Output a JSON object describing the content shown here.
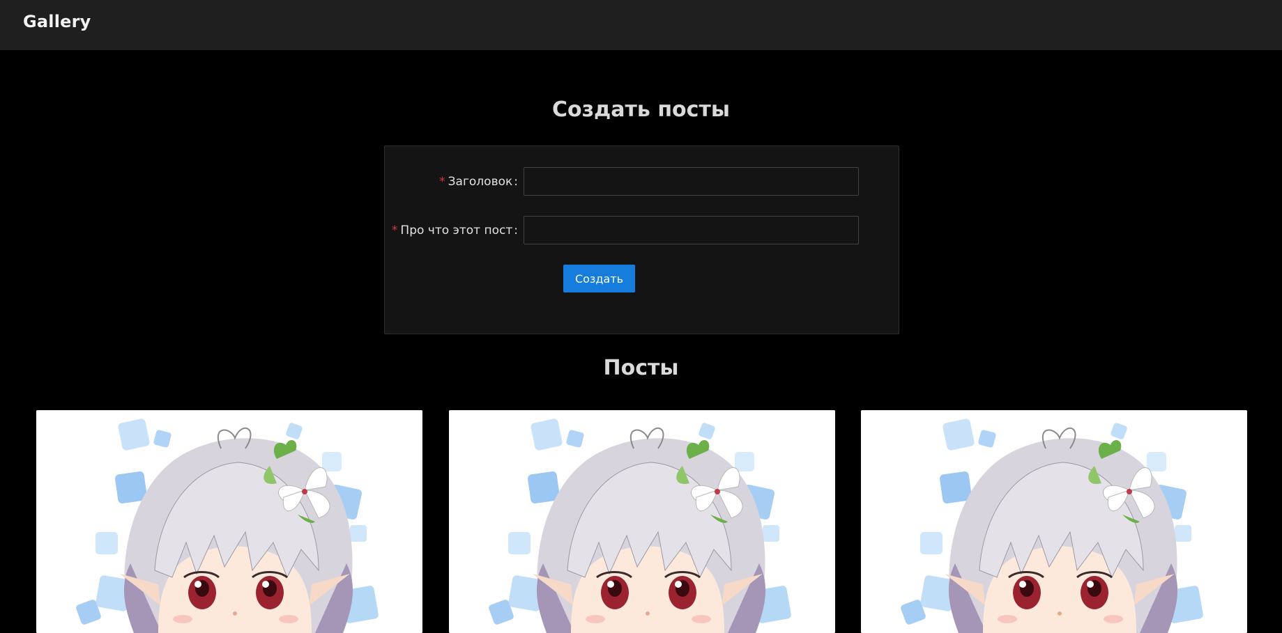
{
  "header": {
    "title": "Gallery"
  },
  "create": {
    "heading": "Создать посты",
    "fields": {
      "title_label": "Заголовок",
      "about_label": "Про что этот пост",
      "required_mark": "*",
      "colon": ":",
      "title_value": "",
      "about_value": ""
    },
    "submit_label": "Создать"
  },
  "posts": {
    "heading": "Посты",
    "items": [
      {
        "image": "anime-girl-illustration"
      },
      {
        "image": "anime-girl-illustration"
      },
      {
        "image": "anime-girl-illustration"
      }
    ]
  },
  "colors": {
    "background": "#000000",
    "header_bg": "#1f1f1f",
    "card_bg": "#141414",
    "accent": "#177ddc",
    "required": "#d8373e"
  }
}
